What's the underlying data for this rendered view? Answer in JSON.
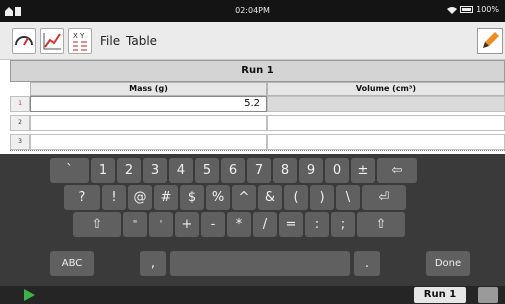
{
  "status": {
    "time": "02:04PM",
    "battery": "100%"
  },
  "toolbar": {
    "menu_file": "File",
    "menu_table": "Table",
    "table_icon_text": "X Y"
  },
  "table": {
    "run_title": "Run 1",
    "columns": [
      "Mass (g)",
      "Volume (cm³)"
    ],
    "rows": [
      {
        "num": "1",
        "mass": "5.2",
        "volume": ""
      },
      {
        "num": "2",
        "mass": "",
        "volume": ""
      },
      {
        "num": "3",
        "mass": "",
        "volume": ""
      }
    ]
  },
  "keyboard": {
    "row1": [
      "`",
      "1",
      "2",
      "3",
      "4",
      "5",
      "6",
      "7",
      "8",
      "9",
      "0",
      "±",
      "⇦"
    ],
    "row2": [
      "?",
      "!",
      "@",
      "#",
      "$",
      "%",
      "^",
      "&",
      "(",
      ")",
      "\\",
      "⏎"
    ],
    "row3": [
      "⇧",
      "\"",
      "'",
      "+",
      "-",
      "*",
      "/",
      "=",
      ":",
      ";",
      "⇧"
    ],
    "row4": {
      "abc": "ABC",
      "comma": ",",
      "period": ".",
      "done": "Done"
    }
  },
  "bottom": {
    "run_label": "Run 1"
  },
  "colors": {
    "play": "#3cb24a",
    "pencil": "#f28c1e",
    "graph_red": "#d9322b"
  }
}
